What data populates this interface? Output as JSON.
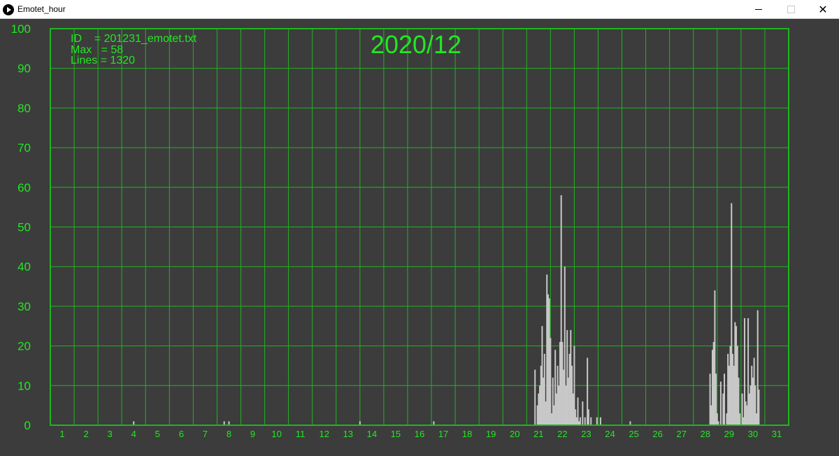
{
  "window": {
    "title": "Emotet_hour",
    "icon": "play-circle-icon",
    "controls": [
      "minimize-icon",
      "maximize-icon",
      "close-icon"
    ]
  },
  "colors": {
    "background": "#3c3c3c",
    "grid": "#1fb51f",
    "text": "#22e822",
    "bar": "#c8c8c8"
  },
  "info": {
    "id_line": "ID    = 201231_emotet.txt",
    "max_line": "Max   = 58",
    "lines_line": "Lines = 1320"
  },
  "chart_data": {
    "type": "bar",
    "title": "2020/12",
    "xlabel": "",
    "ylabel": "",
    "ylim": [
      0,
      100
    ],
    "yticks": [
      0,
      10,
      20,
      30,
      40,
      50,
      60,
      70,
      80,
      90,
      100
    ],
    "xlim": [
      0.5,
      31.5
    ],
    "xticks": [
      1,
      2,
      3,
      4,
      5,
      6,
      7,
      8,
      9,
      10,
      11,
      12,
      13,
      14,
      15,
      16,
      17,
      18,
      19,
      20,
      21,
      22,
      23,
      24,
      25,
      26,
      27,
      28,
      29,
      30,
      31
    ],
    "grid": true,
    "bin": "hour",
    "series": [
      {
        "points": [
          [
            4.0,
            1
          ],
          [
            7.8,
            1
          ],
          [
            8.0,
            1
          ],
          [
            13.5,
            1
          ],
          [
            16.6,
            1
          ],
          [
            20.85,
            14
          ],
          [
            20.95,
            5
          ],
          [
            21.0,
            8
          ],
          [
            21.05,
            10
          ],
          [
            21.1,
            15
          ],
          [
            21.15,
            25
          ],
          [
            21.2,
            12
          ],
          [
            21.25,
            18
          ],
          [
            21.3,
            6
          ],
          [
            21.35,
            38
          ],
          [
            21.4,
            33
          ],
          [
            21.45,
            32
          ],
          [
            21.5,
            22
          ],
          [
            21.55,
            3
          ],
          [
            21.6,
            12
          ],
          [
            21.65,
            5
          ],
          [
            21.7,
            19
          ],
          [
            21.75,
            8
          ],
          [
            21.8,
            15
          ],
          [
            21.85,
            10
          ],
          [
            21.9,
            21
          ],
          [
            21.95,
            58
          ],
          [
            22.0,
            21
          ],
          [
            22.05,
            14
          ],
          [
            22.1,
            40
          ],
          [
            22.15,
            10
          ],
          [
            22.2,
            24
          ],
          [
            22.25,
            12
          ],
          [
            22.3,
            18
          ],
          [
            22.35,
            24
          ],
          [
            22.4,
            15
          ],
          [
            22.45,
            8
          ],
          [
            22.5,
            20
          ],
          [
            22.55,
            4
          ],
          [
            22.6,
            2
          ],
          [
            22.65,
            7
          ],
          [
            22.7,
            1
          ],
          [
            22.75,
            2
          ],
          [
            22.85,
            6
          ],
          [
            22.95,
            2
          ],
          [
            23.05,
            17
          ],
          [
            23.1,
            4
          ],
          [
            23.2,
            2
          ],
          [
            23.45,
            2
          ],
          [
            23.6,
            2
          ],
          [
            24.85,
            1
          ],
          [
            28.2,
            13
          ],
          [
            28.25,
            5
          ],
          [
            28.3,
            19
          ],
          [
            28.35,
            21
          ],
          [
            28.4,
            34
          ],
          [
            28.45,
            13
          ],
          [
            28.5,
            3
          ],
          [
            28.55,
            1
          ],
          [
            28.65,
            11
          ],
          [
            28.75,
            8
          ],
          [
            28.8,
            13
          ],
          [
            28.9,
            3
          ],
          [
            28.95,
            18
          ],
          [
            29.0,
            15
          ],
          [
            29.05,
            20
          ],
          [
            29.1,
            56
          ],
          [
            29.15,
            18
          ],
          [
            29.2,
            15
          ],
          [
            29.25,
            26
          ],
          [
            29.3,
            25
          ],
          [
            29.35,
            20
          ],
          [
            29.4,
            12
          ],
          [
            29.45,
            3
          ],
          [
            29.55,
            8
          ],
          [
            29.6,
            2
          ],
          [
            29.65,
            27
          ],
          [
            29.7,
            6
          ],
          [
            29.75,
            5
          ],
          [
            29.8,
            27
          ],
          [
            29.85,
            8
          ],
          [
            29.9,
            10
          ],
          [
            29.95,
            15
          ],
          [
            30.0,
            12
          ],
          [
            30.05,
            17
          ],
          [
            30.1,
            10
          ],
          [
            30.15,
            3
          ],
          [
            30.2,
            29
          ],
          [
            30.25,
            9
          ]
        ]
      }
    ]
  }
}
